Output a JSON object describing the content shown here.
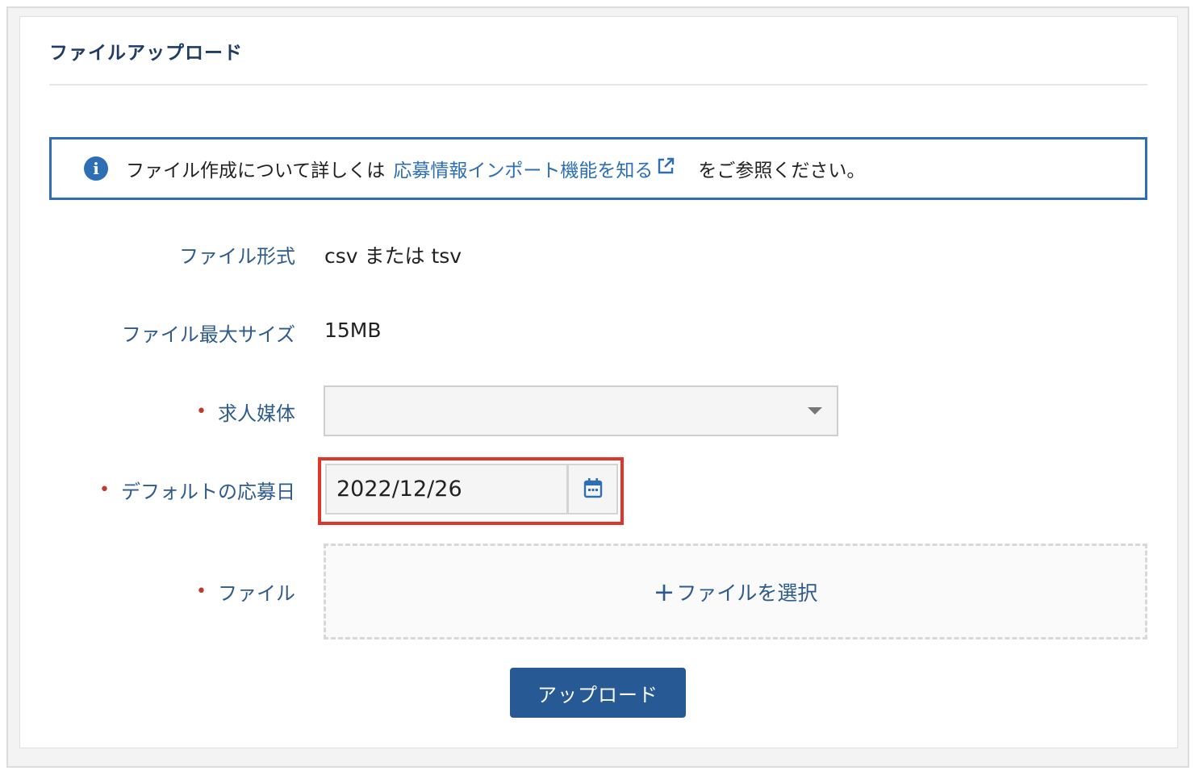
{
  "title": "ファイルアップロード",
  "info": {
    "prefix": "ファイル作成について詳しくは",
    "link": "応募情報インポート機能を知る",
    "suffix": "をご参照ください。"
  },
  "fields": {
    "format_label": "ファイル形式",
    "format_value": "csv または tsv",
    "maxsize_label": "ファイル最大サイズ",
    "maxsize_value": "15MB",
    "media_label": "求人媒体",
    "media_value": "",
    "date_label": "デフォルトの応募日",
    "date_value": "2022/12/26",
    "file_label": "ファイル"
  },
  "required_mark": "•",
  "dropzone": {
    "plus": "+",
    "label": "ファイルを選択"
  },
  "upload_label": "アップロード",
  "colors": {
    "accent": "#2d6eb4",
    "button": "#275a95",
    "required": "#c0392b",
    "highlight": "#e0352b"
  },
  "icons": [
    "info-icon",
    "external-link-icon",
    "chevron-down-icon",
    "calendar-icon",
    "plus-icon"
  ]
}
